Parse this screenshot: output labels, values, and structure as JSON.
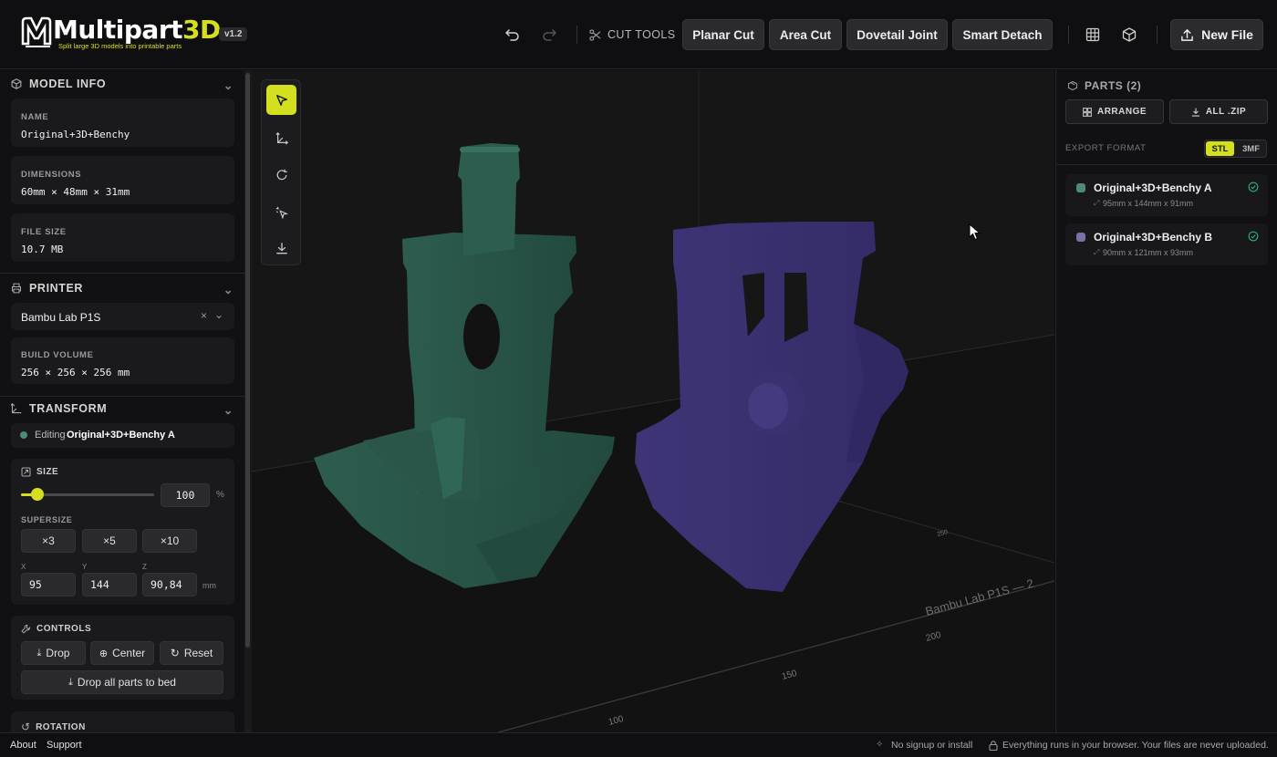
{
  "app": {
    "title_main": "Multipart",
    "title_accent": "3D",
    "subtitle": "Split large 3D models into printable parts",
    "version": "v1.2"
  },
  "toolbar": {
    "cut_tools_label": "CUT TOOLS",
    "tools": [
      "Planar Cut",
      "Area Cut",
      "Dovetail Joint",
      "Smart Detach"
    ],
    "new_file": "New File"
  },
  "model_info": {
    "header": "MODEL INFO",
    "name_label": "NAME",
    "name": "Original+3D+Benchy",
    "dimensions_label": "DIMENSIONS",
    "dimensions": "60mm × 48mm × 31mm",
    "file_size_label": "FILE SIZE",
    "file_size": "10.7 MB"
  },
  "printer": {
    "header": "PRINTER",
    "selected": "Bambu Lab P1S",
    "build_volume_label": "BUILD VOLUME",
    "build_volume": "256 × 256 × 256 mm"
  },
  "transform": {
    "header": "TRANSFORM",
    "editing_prefix": "Editing",
    "editing_part": "Original+3D+Benchy A",
    "size_label": "SIZE",
    "size_value": "100",
    "size_unit": "%",
    "size_slider_fraction": 0.12,
    "supersize_label": "SUPERSIZE",
    "supersize_options": [
      "×3",
      "×5",
      "×10"
    ],
    "x_label": "X",
    "y_label": "Y",
    "z_label": "Z",
    "x": "95",
    "y": "144",
    "z": "90,84",
    "unit": "mm"
  },
  "controls": {
    "header": "CONTROLS",
    "drop": "Drop",
    "center": "Center",
    "reset": "Reset",
    "drop_all": "Drop all parts to bed"
  },
  "rotation": {
    "header": "ROTATION"
  },
  "viewport": {
    "printer_label": "Bambu Lab P1S — 2",
    "axis_ticks": [
      "100",
      "150",
      "200",
      "250"
    ]
  },
  "parts": {
    "header": "PARTS (2)",
    "arrange": "ARRANGE",
    "all_zip": "ALL .ZIP",
    "export_format_label": "EXPORT FORMAT",
    "formats": [
      "STL",
      "3MF"
    ],
    "selected_format": "STL",
    "items": [
      {
        "name": "Original+3D+Benchy A",
        "dims": "95mm x 144mm x 91mm",
        "color": "#4e8a78"
      },
      {
        "name": "Original+3D+Benchy B",
        "dims": "90mm x 121mm x 93mm",
        "color": "#7b6fa8"
      }
    ]
  },
  "footer": {
    "about": "About",
    "support": "Support",
    "no_signup": "No signup or install",
    "privacy": "Everything runs in your browser. Your files are never uploaded."
  },
  "colors": {
    "accent": "#d4e01f",
    "part_a": "#2b5a4c",
    "part_b": "#3f3777",
    "success": "#2fb87a"
  }
}
